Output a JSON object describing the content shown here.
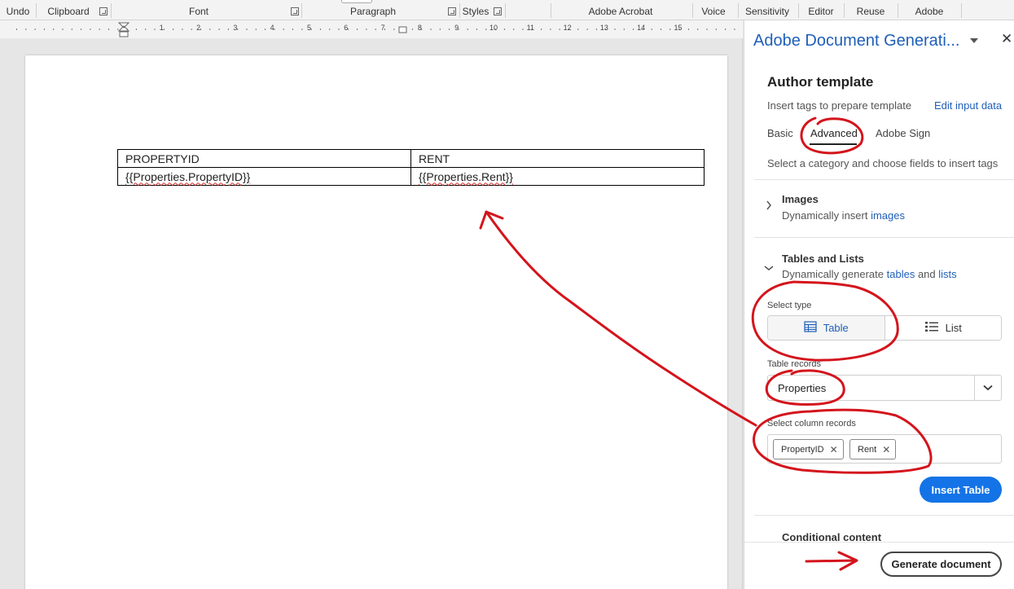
{
  "ribbon": {
    "groups": [
      "Undo",
      "Clipboard",
      "Font",
      "Paragraph",
      "Styles",
      "Adobe Acrobat",
      "Voice",
      "Sensitivity",
      "Editor",
      "Reuse Files",
      "Adobe"
    ]
  },
  "ruler": {
    "numbers": [
      "1",
      "2",
      "3",
      "4",
      "5",
      "6",
      "7",
      "8",
      "9",
      "10",
      "11",
      "12",
      "13",
      "14",
      "15"
    ]
  },
  "document": {
    "table": {
      "header": [
        "PROPERTYID",
        "RENT"
      ],
      "row": [
        "{{Properties.PropertyID}}",
        "{{Properties.Rent}}"
      ]
    }
  },
  "panel": {
    "title": "Adobe Document Generati...",
    "close": "✕",
    "author_title": "Author template",
    "insert_tags": "Insert tags to prepare template",
    "edit_input": "Edit input data",
    "tabs": [
      "Basic",
      "Advanced",
      "Adobe Sign"
    ],
    "select_category": "Select a category and choose fields to insert tags",
    "images": {
      "title": "Images",
      "desc_prefix": "Dynamically insert ",
      "desc_link": "images"
    },
    "tables_lists": {
      "title": "Tables and Lists",
      "desc_prefix": "Dynamically generate ",
      "desc_link1": "tables",
      "desc_mid": " and ",
      "desc_link2": "lists"
    },
    "select_type_label": "Select type",
    "type_options": [
      "Table",
      "List"
    ],
    "table_records_label": "Table records",
    "table_records_value": "Properties",
    "select_columns_label": "Select column records",
    "column_chips": [
      "PropertyID",
      "Rent"
    ],
    "chip_remove": "✕",
    "insert_table": "Insert Table",
    "conditional_title": "Conditional content",
    "generate_document": "Generate document"
  },
  "colors": {
    "accent_blue": "#1473e6",
    "link_blue": "#1f5fb8",
    "annotation_red": "#d4141c"
  }
}
